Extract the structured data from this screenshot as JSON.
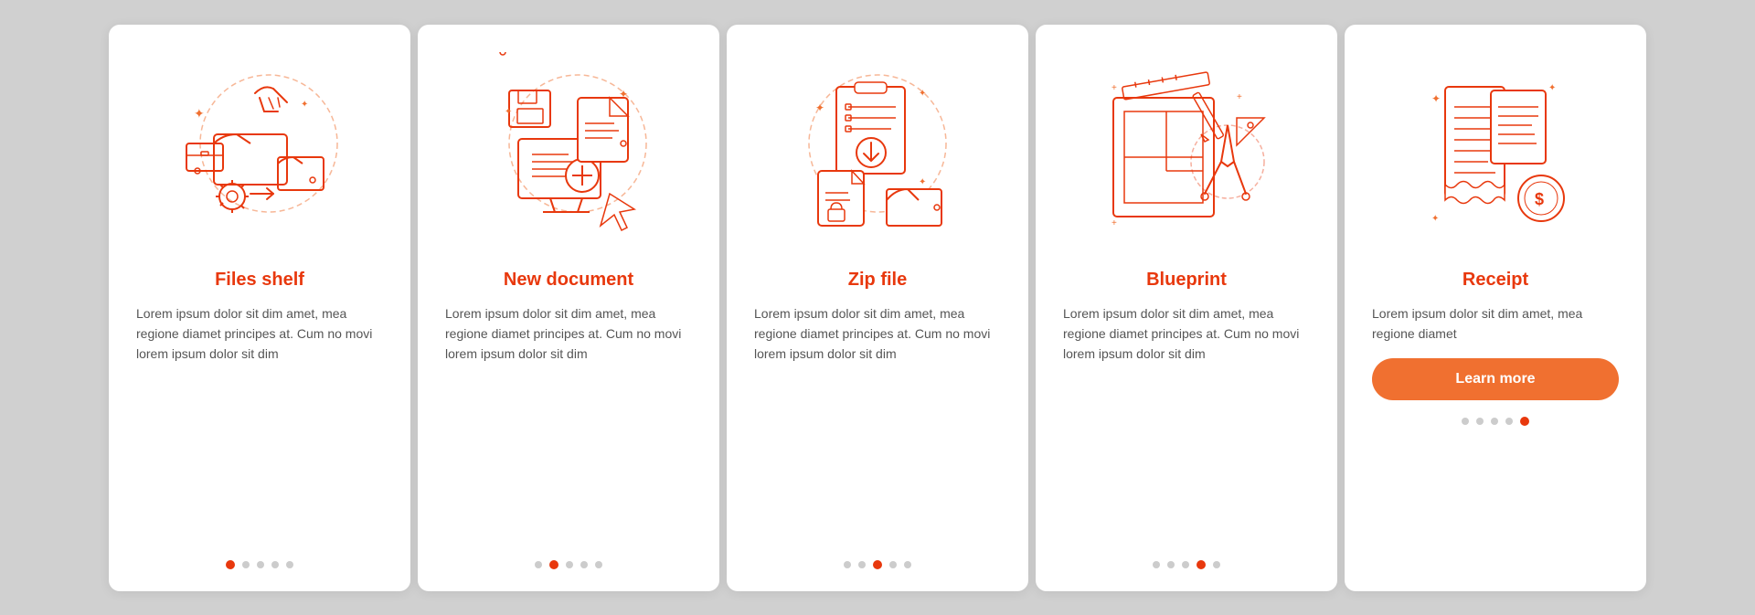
{
  "cards": [
    {
      "id": "files-shelf",
      "title": "Files shelf",
      "body": "Lorem ipsum dolor sit dim amet, mea regione diamet principes at. Cum no movi lorem ipsum dolor sit dim",
      "active_dot": 0,
      "dot_count": 5,
      "has_button": false
    },
    {
      "id": "new-document",
      "title": "New document",
      "body": "Lorem ipsum dolor sit dim amet, mea regione diamet principes at. Cum no movi lorem ipsum dolor sit dim",
      "active_dot": 1,
      "dot_count": 5,
      "has_button": false
    },
    {
      "id": "zip-file",
      "title": "Zip file",
      "body": "Lorem ipsum dolor sit dim amet, mea regione diamet principes at. Cum no movi lorem ipsum dolor sit dim",
      "active_dot": 2,
      "dot_count": 5,
      "has_button": false
    },
    {
      "id": "blueprint",
      "title": "Blueprint",
      "body": "Lorem ipsum dolor sit dim amet, mea regione diamet principes at. Cum no movi lorem ipsum dolor sit dim",
      "active_dot": 3,
      "dot_count": 5,
      "has_button": false
    },
    {
      "id": "receipt",
      "title": "Receipt",
      "body": "Lorem ipsum dolor sit dim amet, mea regione diamet",
      "active_dot": 4,
      "dot_count": 5,
      "has_button": true,
      "button_label": "Learn more"
    }
  ],
  "accent_color": "#e8380d",
  "text_color": "#555555"
}
